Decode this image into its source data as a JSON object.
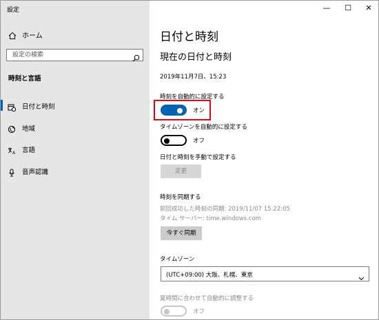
{
  "window": {
    "title": "設定"
  },
  "controls": {
    "minimize": "—",
    "maximize": "☐",
    "close": "✕"
  },
  "sidebar": {
    "home_label": "ホーム",
    "search_placeholder": "設定の検索",
    "section_title": "時刻と言語",
    "items": [
      {
        "label": "日付と時刻",
        "icon": "calendar-clock-icon",
        "selected": true
      },
      {
        "label": "地域",
        "icon": "globe-icon",
        "selected": false
      },
      {
        "label": "言語",
        "icon": "language-icon",
        "selected": false
      },
      {
        "label": "音声認識",
        "icon": "microphone-icon",
        "selected": false
      }
    ]
  },
  "main": {
    "title": "日付と時刻",
    "subtitle": "現在の日付と時刻",
    "current_datetime": "2019年11月7日、15:23",
    "auto_time": {
      "label": "時刻を自動的に設定する",
      "state": "オン",
      "on": true
    },
    "auto_timezone": {
      "label": "タイムゾーンを自動的に設定する",
      "state": "オフ",
      "on": false
    },
    "manual": {
      "label": "日付と時刻を手動で設定する",
      "button": "変更"
    },
    "sync": {
      "heading": "時刻を同期する",
      "last_sync": "前回成功した時刻の同期: 2019/11/07 15:22:05",
      "server": "タイム サーバー: time.windows.com",
      "button": "今すぐ同期"
    },
    "timezone": {
      "label": "タイムゾーン",
      "value": "(UTC+09:00) 大阪、札幌、東京"
    },
    "dst": {
      "label": "夏時間に合わせて自動的に調整する",
      "state": "オフ",
      "on": false
    }
  },
  "colors": {
    "accent": "#0063b1",
    "highlight": "#e60012",
    "sidebar_bg": "#e6e6e6"
  }
}
